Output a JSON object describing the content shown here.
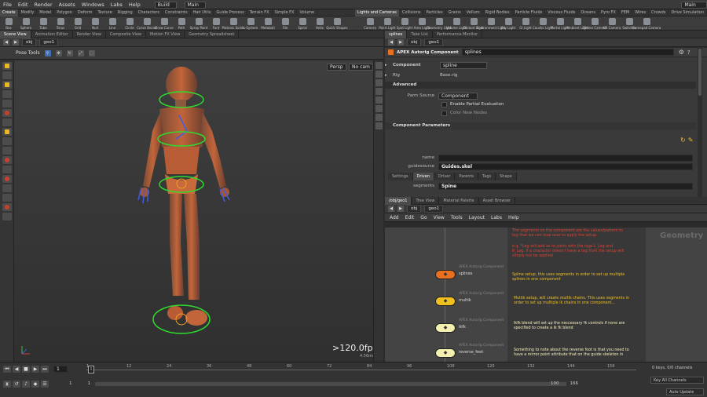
{
  "menubar": {
    "items": [
      "File",
      "Edit",
      "Render",
      "Assets",
      "Windows",
      "Labs",
      "Help"
    ],
    "desktop": "Build",
    "context": "Main",
    "right_context": "Main"
  },
  "shelf_tabs_left": [
    "Create",
    "Modify",
    "Model",
    "Polygon",
    "Deform",
    "Texture",
    "Rigging",
    "Characters",
    "Constraints",
    "Hair Utils",
    "Guide Process",
    "Terrain FX",
    "Simple FX",
    "Volume"
  ],
  "shelf_tabs_right": [
    "Lights and Cameras",
    "Collisions",
    "Particles",
    "Grains",
    "Vellum",
    "Rigid Bodies",
    "Particle Fluids",
    "Viscous Fluids",
    "Oceans",
    "Pyro FX",
    "FEM",
    "Wires",
    "Crowds",
    "Drive Simulation"
  ],
  "shelf_tools_left": [
    "Box",
    "Sphere",
    "Tube",
    "Torus",
    "Grid",
    "Null",
    "Line",
    "Circle",
    "Curve Bezier",
    "Draw Curve",
    "Path",
    "Spray Paint",
    "Font",
    "Platonic Solids",
    "L-System",
    "Metaball",
    "File",
    "Spiral",
    "Helix",
    "Quick Shapes"
  ],
  "shelf_tools_right": [
    "Camera",
    "Point Light",
    "Spot Light",
    "Area Light",
    "Geometry Light",
    "Volume Light",
    "Distant Light",
    "Environment Light",
    "Sky Light",
    "GI Light",
    "Caustic Light",
    "Portal Light",
    "Ambient Light",
    "Stereo Camera",
    "VR Camera",
    "Switcher",
    "Gamepad Camera"
  ],
  "left_pane": {
    "tabs": [
      "Scene View",
      "Animation Editor",
      "Render View",
      "Composite View",
      "Motion FX View",
      "Geometry Spreadsheet"
    ],
    "path": [
      "obj",
      "geo1"
    ],
    "tool_label": "Pose Tools",
    "persp": "Persp",
    "cam": "No cam",
    "fps": ">120.0fps",
    "ms": "4.56ms"
  },
  "param_pane": {
    "tabs": [
      "splines",
      "Take List",
      "Performance Monitor"
    ],
    "path": [
      "obj",
      "geo1"
    ],
    "node_type": "APEX Autorig Component",
    "node_name": "splines",
    "component_label": "Component",
    "component_value": "spline",
    "rig_label": "Rig",
    "rig_value": "Base.rig",
    "advanced_label": "Advanced",
    "parm_source_label": "Parm Source",
    "parm_source_value": "Component",
    "enable_partial": "Enable Partial Evaluation",
    "color_new_nodes": "Color New Nodes",
    "component_params": "Component Parameters",
    "name_label": "name",
    "guidesource_label": "guidesource",
    "guidesource_value": "Guides.skel",
    "subtabs": [
      "Settings",
      "Driven",
      "Driver",
      "Parents",
      "Tags",
      "Shape"
    ],
    "segments_label": "segments",
    "segments_value": "Spine"
  },
  "network_pane": {
    "tabs": [
      "/obj/geo1",
      "Tree View",
      "Material Palette",
      "Asset Browser"
    ],
    "path": [
      "obj",
      "geo1"
    ],
    "menu": [
      "Add",
      "Edit",
      "Go",
      "View",
      "Tools",
      "Layout",
      "Labs",
      "Help"
    ],
    "watermark": "Geometry",
    "notes": [
      {
        "text": "The segments on the component are the values/pattern to tag that we can loop over to apply the setup.",
        "color": "#e04030"
      },
      {
        "text": "e.g. *Leg will add as to joints with the tags L_Leg and R_Leg. If a character doesn't have a tag from the setup will simply not be applied",
        "color": "#e04030"
      },
      {
        "text": "Spline setup, this uses segments in order to set up multiple splines in one component",
        "color": "#f0c020"
      },
      {
        "text": "Multik setup, will create multik chains. This uses segments in order to set up multiple ik chains in one component...",
        "color": "#f0c020"
      },
      {
        "text": "Ikfk blend will set up the neccessary fk controls if none are specified to create a ik fk blend",
        "color": "#f5f0c0"
      },
      {
        "text": "Something to note about the reverse foot is that you need to have a mirror point attribute that on the guide skeleton in",
        "color": "#f5f0c0"
      }
    ],
    "nodes": [
      {
        "type": "APEX Autorig Component",
        "name": "splines",
        "color": "#e87020"
      },
      {
        "type": "APEX Autorig Component",
        "name": "multik",
        "color": "#f0c020"
      },
      {
        "type": "APEX Autorig Component",
        "name": "ikfk",
        "color": "#f5f0b0"
      },
      {
        "type": "APEX Autorig Component",
        "name": "reverse_feet",
        "color": "#f5f0b0"
      }
    ]
  },
  "timeline": {
    "frame": "1",
    "ticks": [
      "1",
      "12",
      "24",
      "36",
      "48",
      "60",
      "72",
      "84",
      "96",
      "108",
      "120",
      "132",
      "144",
      "156"
    ],
    "start": "1",
    "start2": "1",
    "end": "100",
    "end2": "166",
    "keys": "0 keys, 0/0 channels",
    "key_all": "Key All Channels",
    "auto_update": "Auto Update"
  }
}
